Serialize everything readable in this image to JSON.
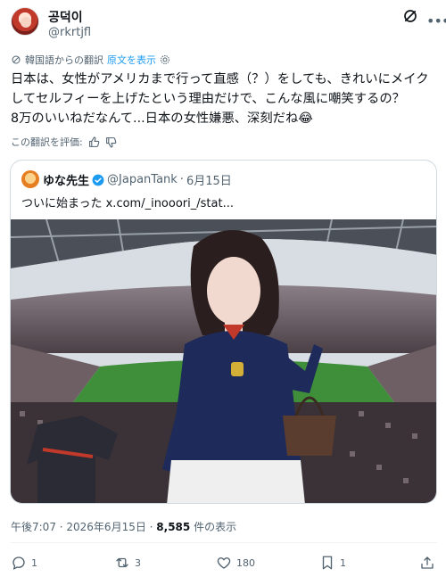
{
  "author": {
    "display_name": "공덕이",
    "handle": "@rkrtjfl"
  },
  "translation": {
    "label": "韓国語からの翻訳",
    "show_original": "原文を表示"
  },
  "tweet": {
    "lines": [
      "日本は、女性がアメリカまで行って直感（？）をしても、きれいにメイク",
      "してセルフィーを上げたという理由だけで、こんな風に嘲笑するの？",
      "8万のいいねだなんて...日本の女性嫌悪、深刻だね😂"
    ]
  },
  "rate_translation": {
    "label": "この翻訳を評価:"
  },
  "quote": {
    "display_name": "ゆな先生",
    "handle": "@JapanTank",
    "separator": "·",
    "date": "6月15日",
    "text": "ついに始まった  x.com/_inooori_/stat..."
  },
  "meta": {
    "time_date": "午後7:07 · 2026年6月15日 · ",
    "views": "8,585",
    "views_label": " 件の表示"
  },
  "actions": {
    "reply_count": "1",
    "repost_count": "3",
    "like_count": "180",
    "bookmark_count": "1"
  },
  "colors": {
    "link": "#1d9bf0",
    "secondary_text": "#536471",
    "border": "#cfd9de",
    "verified": "#1d9bf0"
  },
  "icons": [
    "grok-icon",
    "more-icon",
    "translate-icon",
    "settings-icon",
    "thumbs-up-icon",
    "thumbs-down-icon",
    "verified-badge-icon",
    "reply-icon",
    "repost-icon",
    "like-icon",
    "bookmark-icon",
    "share-icon"
  ]
}
